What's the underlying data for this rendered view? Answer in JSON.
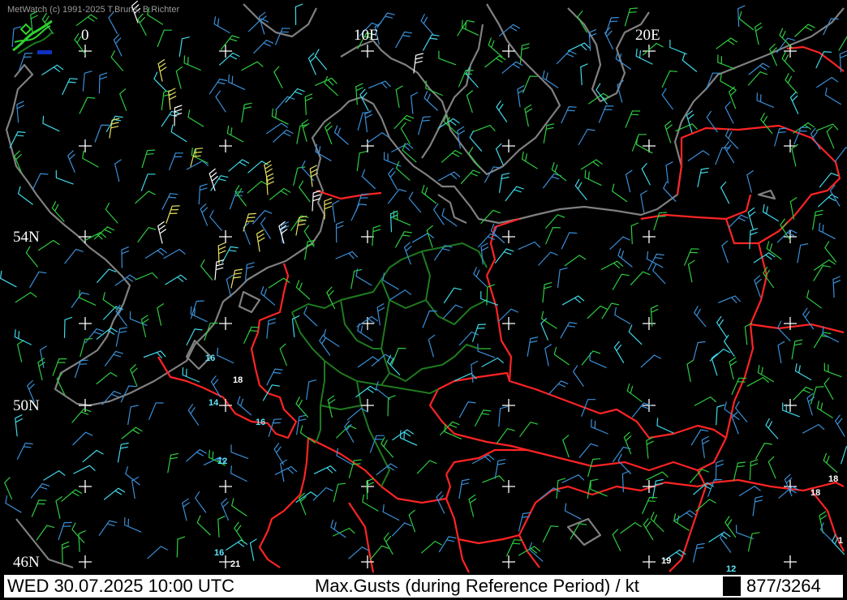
{
  "credit": "MetWatch  (c) 1991-2025 T.Bruns, B.Richter",
  "longitude_labels": [
    "0",
    "10E",
    "20E"
  ],
  "latitude_labels": [
    "54N",
    "50N",
    "46N"
  ],
  "status_bar": {
    "datetime": "WED 30.07.2025 10:00 UTC",
    "parameter": "Max.Gusts (during Reference Period) / kt",
    "count": "877/3264"
  },
  "station_values": [
    "16",
    "18",
    "14",
    "16",
    "12",
    "16",
    "21",
    "19",
    "12",
    "18",
    "18",
    "1"
  ],
  "colors": {
    "background": "#000000",
    "coastline": "#808080",
    "country_border": "#ff2020",
    "german_state_border": "#1f7a1f",
    "grid_cross": "#ffffff",
    "wind_blue": "#3a8fd8",
    "wind_green": "#2ecc40",
    "wind_cyan": "#40d8e8",
    "wind_yellow": "#e8e060",
    "wind_white": "#ffffff"
  },
  "icons": [
    "metwatch-logo-icon"
  ]
}
